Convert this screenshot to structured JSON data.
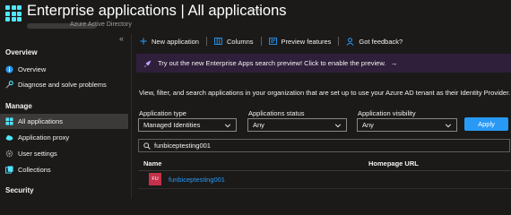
{
  "header": {
    "title": "Enterprise applications | All applications",
    "more": "···",
    "subtitle": "Azure Active Directory"
  },
  "sidebar": {
    "collapse": "«",
    "sections": {
      "overview": "Overview",
      "manage": "Manage",
      "security": "Security"
    },
    "items": [
      {
        "label": "Overview",
        "icon": "info-icon"
      },
      {
        "label": "Diagnose and solve problems",
        "icon": "wrench-icon"
      },
      {
        "label": "All applications",
        "icon": "grid-icon"
      },
      {
        "label": "Application proxy",
        "icon": "cloud-icon"
      },
      {
        "label": "User settings",
        "icon": "gear-icon"
      },
      {
        "label": "Collections",
        "icon": "collections-icon"
      }
    ]
  },
  "toolbar": {
    "new_application": "New application",
    "columns": "Columns",
    "preview_features": "Preview features",
    "feedback": "Got feedback?"
  },
  "banner": {
    "text": "Try out the new Enterprise Apps search preview! Click to enable the preview.",
    "arrow": "→"
  },
  "description": "View, filter, and search applications in your organization that are set up to use your Azure AD tenant as their Identity Provider.",
  "filters": {
    "application_type": {
      "label": "Application type",
      "value": "Managed Identities"
    },
    "application_status": {
      "label": "Applications status",
      "value": "Any"
    },
    "application_visibility": {
      "label": "Application visibility",
      "value": "Any"
    },
    "apply": "Apply"
  },
  "search": {
    "value": "funbiceptesting001"
  },
  "table": {
    "columns": [
      "Name",
      "Homepage URL"
    ],
    "rows": [
      {
        "initials": "FU",
        "name": "funbiceptesting001",
        "homepage": ""
      }
    ]
  },
  "colors": {
    "accent": "#2899f5",
    "avatar": "#c4314b",
    "banner_bg": "#2f1f3a",
    "background": "#1b1a19"
  }
}
